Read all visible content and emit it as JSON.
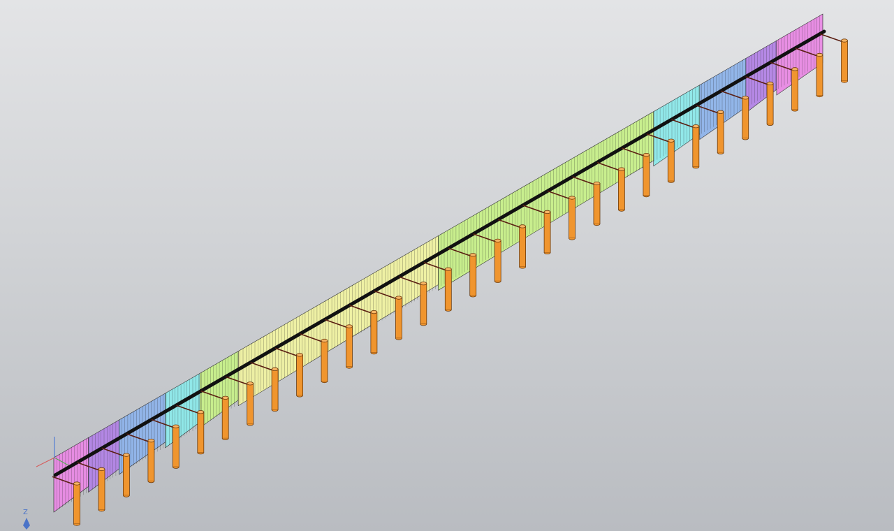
{
  "viewport": {
    "background_top": "#e3e4e6",
    "background_bottom": "#b9bcc1"
  },
  "axis_indicator": {
    "label": "Z",
    "color": "#4a73c8"
  },
  "model": {
    "beam_color": "#111111",
    "pile_color": "#f0952e",
    "pile_edge_color": "#6b3a0c",
    "tie_color": "#5a1e12",
    "outline_color": "#2a2a2a",
    "pile_count": 32,
    "panel_colors": [
      "#e98ae4",
      "#b384e6",
      "#8fb4ea",
      "#8ee9ea",
      "#c8f08a",
      "#f0f2a2",
      "#c8f08a",
      "#8ee9ea",
      "#8fb4ea",
      "#b384e6",
      "#e98ae4"
    ]
  }
}
